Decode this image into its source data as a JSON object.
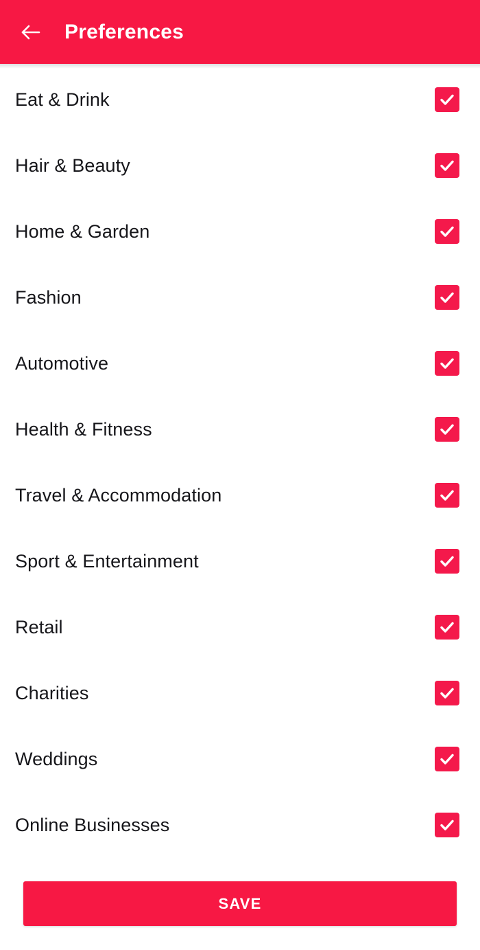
{
  "header": {
    "title": "Preferences",
    "back_icon": "arrow-left-icon",
    "background_color": "#f71844",
    "text_color": "#ffffff"
  },
  "theme": {
    "accent_color": "#f71844",
    "checkbox_color": "#f4194b",
    "page_background": "#ffffff",
    "label_color": "#16161a"
  },
  "preferences": {
    "items": [
      {
        "label": "Eat & Drink",
        "checked": true,
        "checkbox_icon": "check-icon"
      },
      {
        "label": "Hair & Beauty",
        "checked": true,
        "checkbox_icon": "check-icon"
      },
      {
        "label": "Home & Garden",
        "checked": true,
        "checkbox_icon": "check-icon"
      },
      {
        "label": "Fashion",
        "checked": true,
        "checkbox_icon": "check-icon"
      },
      {
        "label": "Automotive",
        "checked": true,
        "checkbox_icon": "check-icon"
      },
      {
        "label": "Health & Fitness",
        "checked": true,
        "checkbox_icon": "check-icon"
      },
      {
        "label": "Travel & Accommodation",
        "checked": true,
        "checkbox_icon": "check-icon"
      },
      {
        "label": "Sport & Entertainment",
        "checked": true,
        "checkbox_icon": "check-icon"
      },
      {
        "label": "Retail",
        "checked": true,
        "checkbox_icon": "check-icon"
      },
      {
        "label": "Charities",
        "checked": true,
        "checkbox_icon": "check-icon"
      },
      {
        "label": "Weddings",
        "checked": true,
        "checkbox_icon": "check-icon"
      },
      {
        "label": "Online Businesses",
        "checked": true,
        "checkbox_icon": "check-icon"
      }
    ]
  },
  "footer": {
    "save_label": "SAVE"
  }
}
